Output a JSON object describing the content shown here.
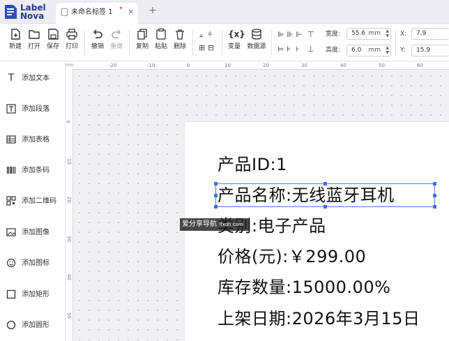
{
  "app": {
    "logo_line1": "Label",
    "logo_line2": "Nova"
  },
  "tab": {
    "title": "未命名标签 1",
    "modified_mark": "*",
    "close": "×",
    "new_tab": "+"
  },
  "toolbar": {
    "new": "新建",
    "open": "打开",
    "save": "保存",
    "print": "打印",
    "undo": "撤销",
    "redo": "重做",
    "copy": "复制",
    "paste": "粘贴",
    "delete": "删除",
    "variable": "变量",
    "datasource": "数据源",
    "width_label": "宽度:",
    "width_value": "55.6",
    "height_label": "高度:",
    "height_value": "6.0",
    "unit": "mm",
    "x_label": "X:",
    "x_value": "7.9",
    "y_label": "Y:",
    "y_value": "15.9"
  },
  "sidebar": {
    "items": [
      {
        "label": "添加文本",
        "icon": "text-icon"
      },
      {
        "label": "添加段落",
        "icon": "paragraph-icon"
      },
      {
        "label": "添加表格",
        "icon": "table-icon"
      },
      {
        "label": "添加条码",
        "icon": "barcode-icon"
      },
      {
        "label": "添加二维码",
        "icon": "qrcode-icon"
      },
      {
        "label": "添加图像",
        "icon": "image-icon"
      },
      {
        "label": "添加图标",
        "icon": "emoji-icon"
      },
      {
        "label": "添加矩形",
        "icon": "rectangle-icon"
      },
      {
        "label": "添加圆形",
        "icon": "circle-icon"
      }
    ]
  },
  "ruler": {
    "unit": "mm",
    "h_ticks": [
      "-20",
      "-10",
      "0",
      "10",
      "20",
      "30",
      "40",
      "50",
      "60"
    ],
    "v_ticks": [
      "0",
      "10",
      "20",
      "30",
      "40",
      "50"
    ]
  },
  "label": {
    "lines": [
      "产品ID:1",
      "产品名称:无线蓝牙耳机",
      "类别:电子产品",
      "价格(元):￥299.00",
      "库存数量:15000.00%",
      "上架日期:2026年3月15日"
    ]
  },
  "watermark": {
    "text": "爱分享导航",
    "url": "ifxdh.com"
  },
  "colors": {
    "accent": "#3f6fe8",
    "logo": "#1f3b8f",
    "modified": "#d02020"
  }
}
